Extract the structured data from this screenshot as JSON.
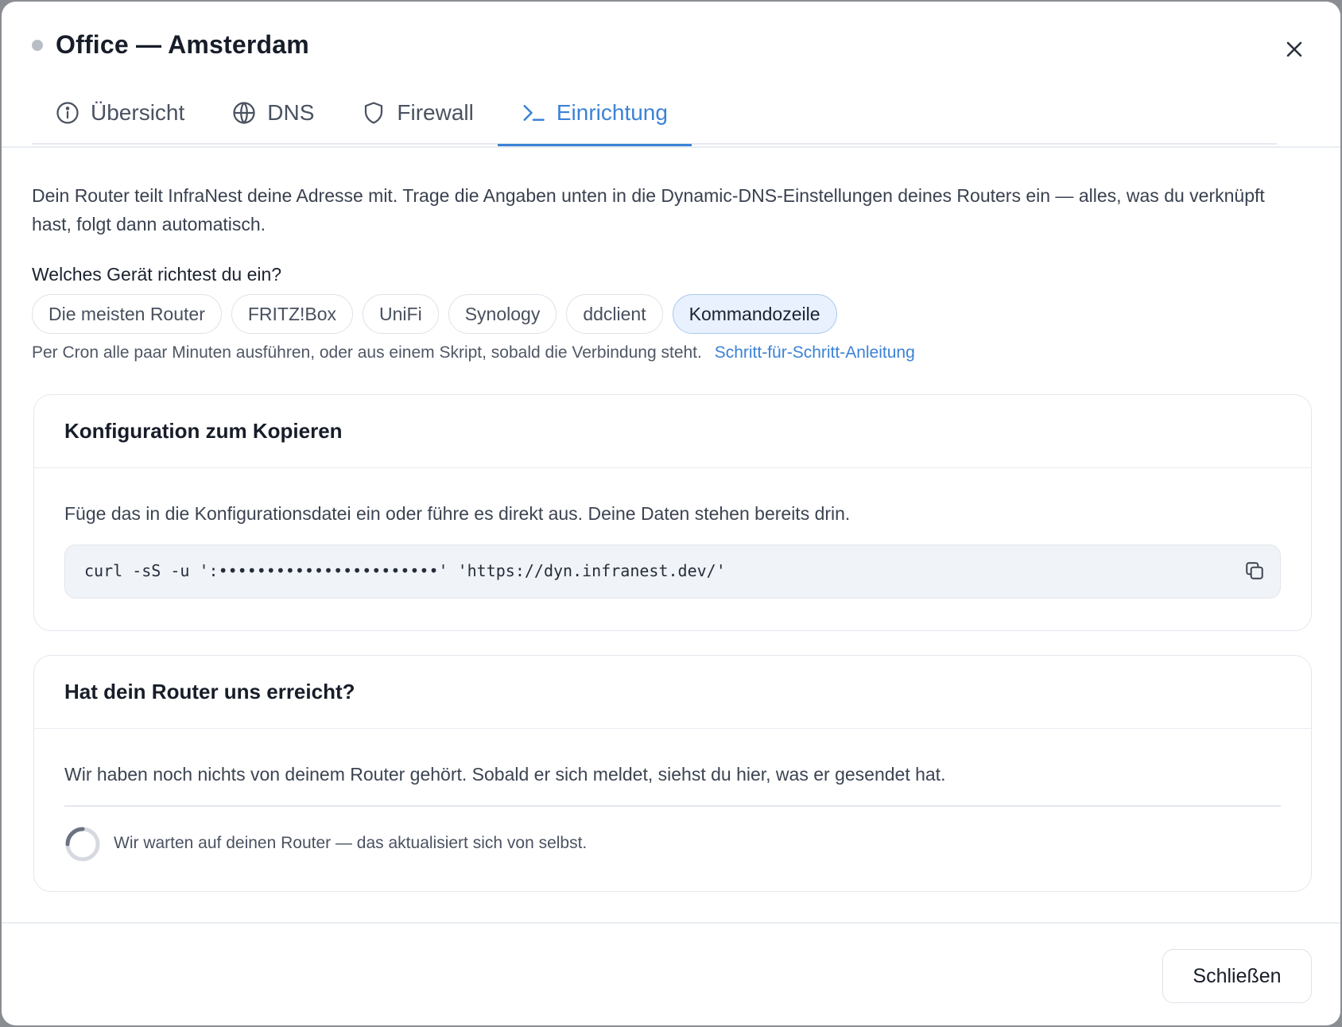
{
  "dialog": {
    "title": "Office — Amsterdam",
    "status_color": "#b9bec6",
    "close_icon": "close-icon"
  },
  "tabs": [
    {
      "label": "Übersicht",
      "icon": "info-icon",
      "active": false
    },
    {
      "label": "DNS",
      "icon": "globe-icon",
      "active": false
    },
    {
      "label": "Firewall",
      "icon": "shield-icon",
      "active": false
    },
    {
      "label": "Einrichtung",
      "icon": "terminal-icon",
      "active": true
    }
  ],
  "accent_color": "#3b82d6",
  "intro_text": "Dein Router teilt InfraNest deine Adresse mit. Trage die Angaben unten in die Dynamic-DNS-Einstellungen deines Routers ein — alles, was du verknüpft hast, folgt dann automatisch.",
  "device_question": "Welches Gerät richtest du ein?",
  "devices": [
    {
      "label": "Die meisten Router",
      "active": false
    },
    {
      "label": "FRITZ!Box",
      "active": false
    },
    {
      "label": "UniFi",
      "active": false
    },
    {
      "label": "Synology",
      "active": false
    },
    {
      "label": "ddclient",
      "active": false
    },
    {
      "label": "Kommandozeile",
      "active": true
    }
  ],
  "hint": {
    "text": "Per Cron alle paar Minuten ausführen, oder aus einem Skript, sobald die Verbindung steht.",
    "link": "Schritt-für-Schritt-Anleitung"
  },
  "config_card": {
    "title": "Konfiguration zum Kopieren",
    "description": "Füge das in die Konfigurationsdatei ein oder führe es direkt aus. Deine Daten stehen bereits drin.",
    "code": "curl -sS -u ':•••••••••••••••••••••••' 'https://dyn.infranest.dev/'",
    "copy_icon": "copy-icon"
  },
  "status_card": {
    "title": "Hat dein Router uns erreicht?",
    "description": "Wir haben noch nichts von deinem Router gehört. Sobald er sich meldet, siehst du hier, was er gesendet hat.",
    "waiting_text": "Wir warten auf deinen Router — das aktualisiert sich von selbst.",
    "spinner_icon": "loading-spinner-icon"
  },
  "footer": {
    "close_label": "Schließen"
  }
}
